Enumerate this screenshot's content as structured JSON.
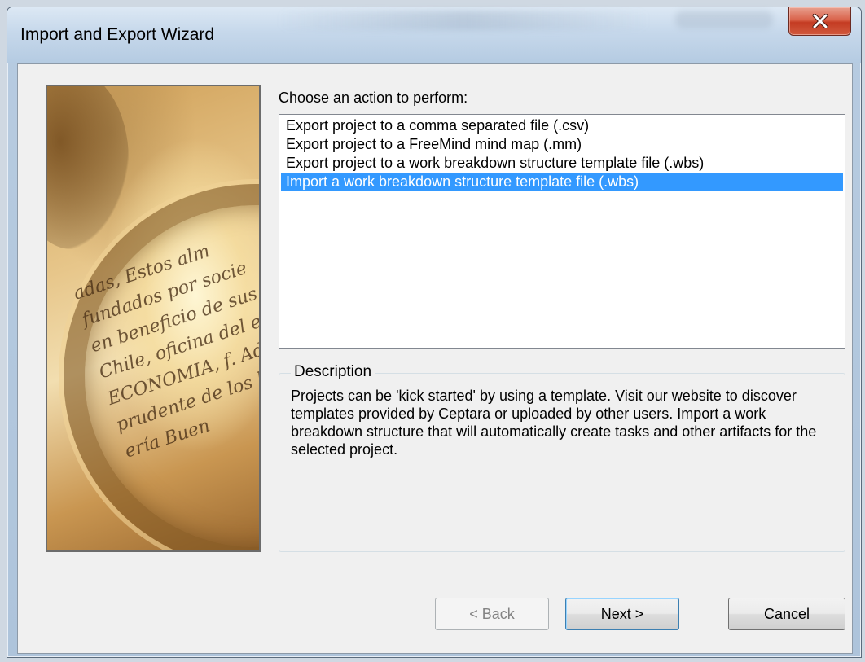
{
  "window": {
    "title": "Import and Export Wizard"
  },
  "picture": {
    "lines": [
      "adas, Estos alm",
      "fundados por socie",
      "en beneficio de sus s",
      "Chile, oficina del ec",
      "ECONOMIA, f. Adm",
      "prudente de los b",
      "ería   Buen"
    ]
  },
  "main": {
    "prompt": "Choose an action to perform:",
    "actions": [
      "Export project to a comma separated file (.csv)",
      "Export project to a FreeMind mind map (.mm)",
      "Export project to a work breakdown structure template file (.wbs)",
      "Import a work breakdown structure template file (.wbs)"
    ],
    "selected_index": 3,
    "description": {
      "label": "Description",
      "text": "Projects can be 'kick started' by using a template.  Visit our website to discover templates provided by Ceptara or uploaded by other users.  Import a work breakdown structure that will automatically create tasks and other artifacts for the selected project."
    }
  },
  "buttons": {
    "back": "< Back",
    "next": "Next >",
    "cancel": "Cancel"
  },
  "colors": {
    "selection": "#3399ff",
    "close_button": "#c43b22"
  }
}
